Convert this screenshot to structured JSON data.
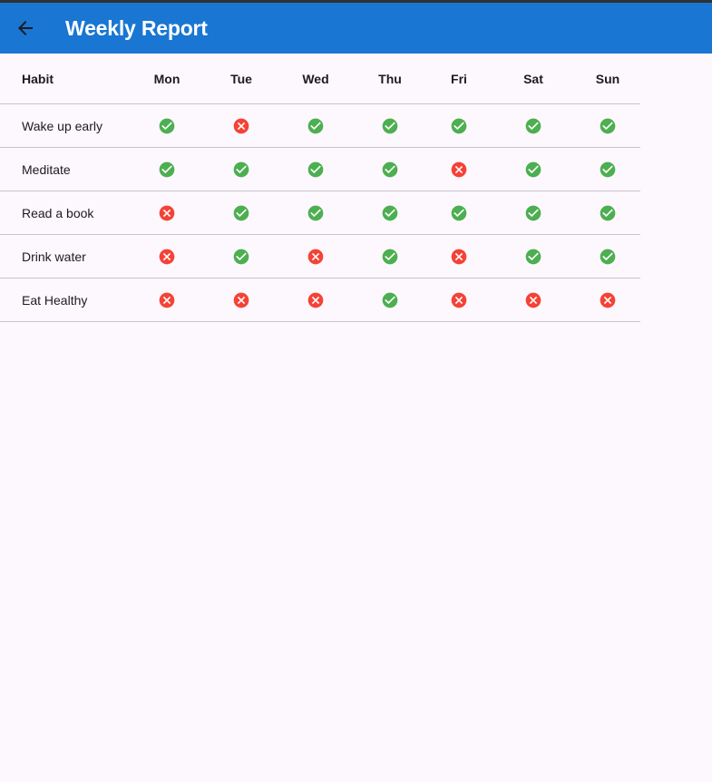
{
  "app_bar": {
    "title": "Weekly Report",
    "back_icon": "arrow-back-icon",
    "color": "#1976d2"
  },
  "table": {
    "habit_header": "Habit",
    "days": [
      "Mon",
      "Tue",
      "Wed",
      "Thu",
      "Fri",
      "Sat",
      "Sun"
    ],
    "rows": [
      {
        "habit": "Wake up early",
        "done": [
          true,
          false,
          true,
          true,
          true,
          true,
          true
        ]
      },
      {
        "habit": "Meditate",
        "done": [
          true,
          true,
          true,
          true,
          false,
          true,
          true
        ]
      },
      {
        "habit": "Read a book",
        "done": [
          false,
          true,
          true,
          true,
          true,
          true,
          true
        ]
      },
      {
        "habit": "Drink water",
        "done": [
          false,
          true,
          false,
          true,
          false,
          true,
          true
        ]
      },
      {
        "habit": "Eat Healthy",
        "done": [
          false,
          false,
          false,
          true,
          false,
          false,
          false
        ]
      }
    ]
  },
  "icons": {
    "done": "check-circle-icon",
    "missed": "cancel-circle-icon"
  },
  "colors": {
    "done": "#4caf50",
    "missed": "#f44336",
    "background": "#fdf7fe"
  }
}
